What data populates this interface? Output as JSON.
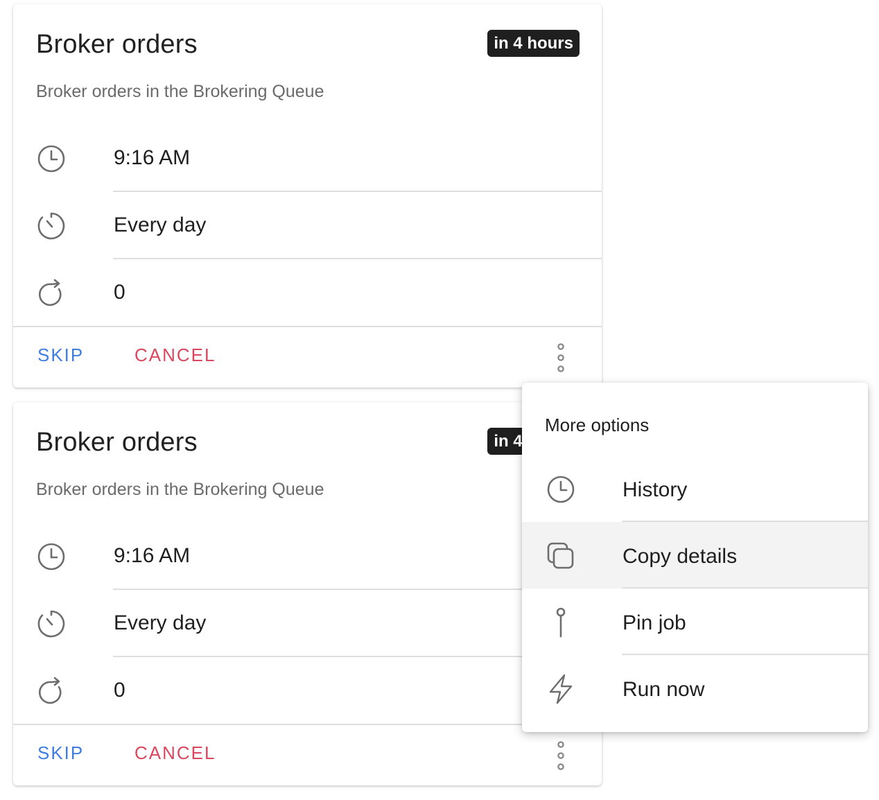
{
  "cards": [
    {
      "title": "Broker orders",
      "badge": "in 4 hours",
      "description": "Broker orders in the Brokering Queue",
      "time": "9:16 AM",
      "frequency": "Every day",
      "retries": "0",
      "skip_label": "SKIP",
      "cancel_label": "CANCEL"
    },
    {
      "title": "Broker orders",
      "badge": "in 4 hours",
      "description": "Broker orders in the Brokering Queue",
      "time": "9:16 AM",
      "frequency": "Every day",
      "retries": "0",
      "skip_label": "SKIP",
      "cancel_label": "CANCEL"
    }
  ],
  "popover": {
    "header": "More options",
    "items": [
      {
        "label": "History",
        "icon": "clock-icon"
      },
      {
        "label": "Copy details",
        "icon": "copy-icon",
        "highlighted": true
      },
      {
        "label": "Pin job",
        "icon": "pin-icon"
      },
      {
        "label": "Run now",
        "icon": "flash-icon"
      }
    ]
  },
  "colors": {
    "skip": "#3f7de0",
    "cancel": "#d9485e",
    "badge_bg": "#1f1f1f",
    "highlight": "#f3f3f3"
  }
}
